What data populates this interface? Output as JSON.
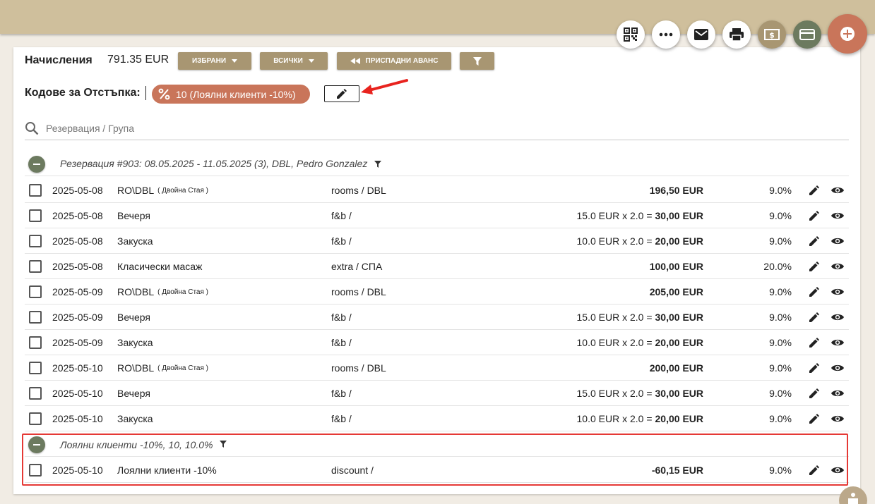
{
  "header": {
    "title": "Начисления",
    "amount": "791.35 EUR",
    "selected_label": "ИЗБРАНИ",
    "all_label": "ВСИЧКИ",
    "deduct_label": "ПРИСПАДНИ АВАНС"
  },
  "discount": {
    "label": "Кодове за Отстъпка:",
    "chip_text": "10 (Лоялни клиенти -10%)"
  },
  "search": {
    "placeholder": "Резервация / Група"
  },
  "groups": [
    {
      "title": "Резервация #903: 08.05.2025 - 11.05.2025 (3), DBL, Pedro Gonzalez"
    },
    {
      "title": "Лоялни клиенти -10%, 10, 10.0%"
    }
  ],
  "rows": [
    {
      "date": "2025-05-08",
      "desc": "RO\\DBL",
      "sub": "( Двойна Стая )",
      "cat": "rooms / DBL",
      "calc": "",
      "amount": "196,50 EUR",
      "vat": "9.0%"
    },
    {
      "date": "2025-05-08",
      "desc": "Вечеря",
      "sub": "",
      "cat": "f&b /",
      "calc": "15.0 EUR x 2.0 =",
      "amount": "30,00 EUR",
      "vat": "9.0%"
    },
    {
      "date": "2025-05-08",
      "desc": "Закуска",
      "sub": "",
      "cat": "f&b /",
      "calc": "10.0 EUR x 2.0 =",
      "amount": "20,00 EUR",
      "vat": "9.0%"
    },
    {
      "date": "2025-05-08",
      "desc": "Класически масаж",
      "sub": "",
      "cat": "extra / СПА",
      "calc": "",
      "amount": "100,00 EUR",
      "vat": "20.0%"
    },
    {
      "date": "2025-05-09",
      "desc": "RO\\DBL",
      "sub": "( Двойна Стая )",
      "cat": "rooms / DBL",
      "calc": "",
      "amount": "205,00 EUR",
      "vat": "9.0%"
    },
    {
      "date": "2025-05-09",
      "desc": "Вечеря",
      "sub": "",
      "cat": "f&b /",
      "calc": "15.0 EUR x 2.0 =",
      "amount": "30,00 EUR",
      "vat": "9.0%"
    },
    {
      "date": "2025-05-09",
      "desc": "Закуска",
      "sub": "",
      "cat": "f&b /",
      "calc": "10.0 EUR x 2.0 =",
      "amount": "20,00 EUR",
      "vat": "9.0%"
    },
    {
      "date": "2025-05-10",
      "desc": "RO\\DBL",
      "sub": "( Двойна Стая )",
      "cat": "rooms / DBL",
      "calc": "",
      "amount": "200,00 EUR",
      "vat": "9.0%"
    },
    {
      "date": "2025-05-10",
      "desc": "Вечеря",
      "sub": "",
      "cat": "f&b /",
      "calc": "15.0 EUR x 2.0 =",
      "amount": "30,00 EUR",
      "vat": "9.0%"
    },
    {
      "date": "2025-05-10",
      "desc": "Закуска",
      "sub": "",
      "cat": "f&b /",
      "calc": "10.0 EUR x 2.0 =",
      "amount": "20,00 EUR",
      "vat": "9.0%"
    }
  ],
  "discount_rows": [
    {
      "date": "2025-05-10",
      "desc": "Лоялни клиенти -10%",
      "sub": "",
      "cat": "discount /",
      "calc": "",
      "amount": "-60,15 EUR",
      "vat": "9.0%"
    }
  ],
  "colors": {
    "topbar": "#cfbf9c",
    "button": "#a89672",
    "chip": "#c9755a",
    "group_icon": "#6c7a5f",
    "highlight": "#e53935"
  }
}
